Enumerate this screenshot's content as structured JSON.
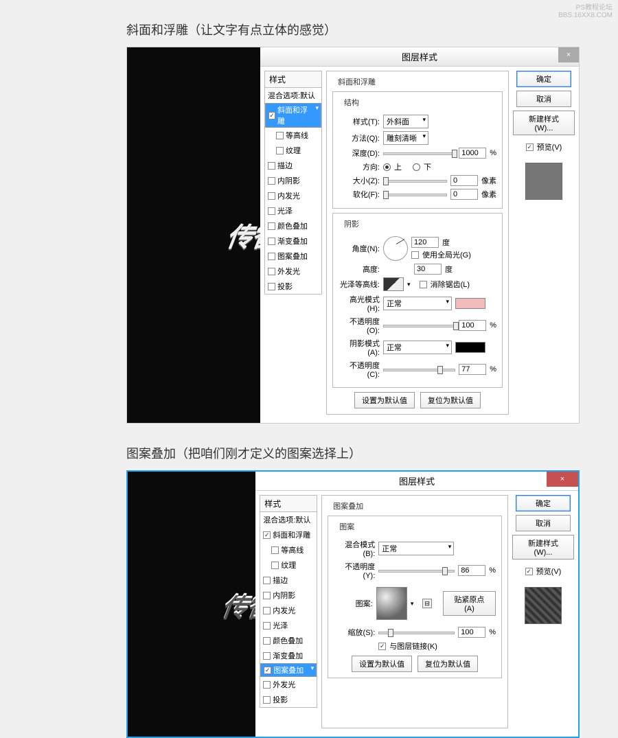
{
  "watermark": {
    "line1": "PS教程论坛",
    "line2": "BBS.16XX8.COM"
  },
  "caption1": "斜面和浮雕（让文字有点立体的感觉）",
  "caption2": "图案叠加（把咱们刚才定义的图案选择上）",
  "preview_text": "传智播",
  "dialog": {
    "title": "图层样式",
    "close": "×",
    "ok": "确定",
    "cancel": "取消",
    "new_style": "新建样式(W)...",
    "preview_chk": "预览(V)"
  },
  "styles": {
    "header": "样式",
    "blend": "混合选项:默认",
    "bevel": "斜面和浮雕",
    "contour": "等高线",
    "texture": "纹理",
    "stroke": "描边",
    "inner_shadow": "内阴影",
    "inner_glow": "内发光",
    "satin": "光泽",
    "color_overlay": "颜色叠加",
    "grad_overlay": "渐变叠加",
    "pattern_overlay": "图案叠加",
    "outer_glow": "外发光",
    "drop_shadow": "投影"
  },
  "bevel": {
    "group": "斜面和浮雕",
    "struct": "结构",
    "style_lbl": "样式(T):",
    "style_val": "外斜面",
    "tech_lbl": "方法(Q):",
    "tech_val": "雕刻清晰",
    "depth_lbl": "深度(D):",
    "depth_val": "1000",
    "pct": "%",
    "dir_lbl": "方向:",
    "up": "上",
    "down": "下",
    "size_lbl": "大小(Z):",
    "size_val": "0",
    "px": "像素",
    "soften_lbl": "软化(F):",
    "soften_val": "0",
    "shade": "阴影",
    "angle_lbl": "角度(N):",
    "angle_val": "120",
    "deg": "度",
    "global": "使用全局光(G)",
    "alt_lbl": "高度:",
    "alt_val": "30",
    "gloss_lbl": "光泽等高线:",
    "anti": "消除锯齿(L)",
    "hmode_lbl": "高光模式(H):",
    "hmode_val": "正常",
    "hopac_lbl": "不透明度(O):",
    "hopac_val": "100",
    "smode_lbl": "阴影模式(A):",
    "smode_val": "正常",
    "sopac_lbl": "不透明度(C):",
    "sopac_val": "77",
    "reset": "设置为默认值",
    "restore": "复位为默认值"
  },
  "pattern": {
    "group": "图案叠加",
    "sub": "图案",
    "blend_lbl": "混合模式(B):",
    "blend_val": "正常",
    "opac_lbl": "不透明度(Y):",
    "opac_val": "86",
    "pct": "%",
    "pat_lbl": "图案:",
    "snap": "贴紧原点(A)",
    "scale_lbl": "缩放(S):",
    "scale_val": "100",
    "link": "与图层链接(K)",
    "reset": "设置为默认值",
    "restore": "复位为默认值"
  }
}
